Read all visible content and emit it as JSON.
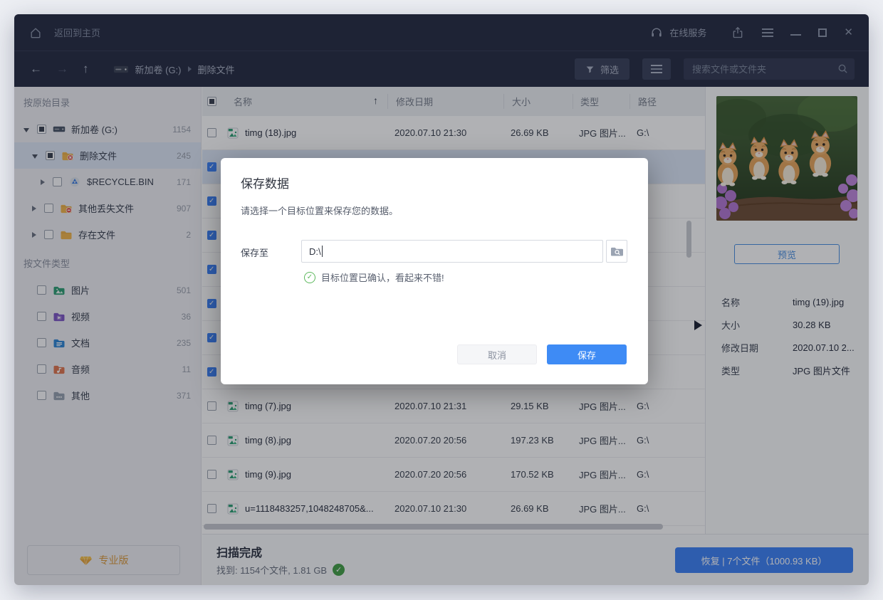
{
  "titlebar": {
    "home": "返回到主页",
    "online_service": "在线服务"
  },
  "toolbar": {
    "crumb_drive": "新加卷 (G:)",
    "crumb_folder": "删除文件",
    "filter": "筛选",
    "search_placeholder": "搜索文件或文件夹"
  },
  "sidebar": {
    "section_origin": "按原始目录",
    "section_types": "按文件类型",
    "origin_items": [
      {
        "label": "新加卷 (G:)",
        "count": "1154",
        "level": 0,
        "arrow": "down",
        "checkbox": "partial",
        "icon": "drive",
        "selected": false
      },
      {
        "label": "删除文件",
        "count": "245",
        "level": 1,
        "arrow": "down",
        "checkbox": "partial",
        "icon": "folder-deleted",
        "selected": true
      },
      {
        "label": "$RECYCLE.BIN",
        "count": "171",
        "level": 2,
        "arrow": "right",
        "checkbox": "empty",
        "icon": "recycle",
        "selected": false
      },
      {
        "label": "其他丢失文件",
        "count": "907",
        "level": 1,
        "arrow": "right",
        "checkbox": "empty",
        "icon": "folder-lost",
        "selected": false
      },
      {
        "label": "存在文件",
        "count": "2",
        "level": 1,
        "arrow": "right",
        "checkbox": "empty",
        "icon": "folder-plain",
        "selected": false
      }
    ],
    "type_items": [
      {
        "label": "图片",
        "count": "501",
        "icon": "folder-pictures"
      },
      {
        "label": "视频",
        "count": "36",
        "icon": "folder-videos"
      },
      {
        "label": "文档",
        "count": "235",
        "icon": "folder-docs"
      },
      {
        "label": "音频",
        "count": "11",
        "icon": "folder-audio"
      },
      {
        "label": "其他",
        "count": "371",
        "icon": "folder-other"
      }
    ],
    "pro_button": "专业版"
  },
  "file_list": {
    "columns": {
      "name": "名称",
      "date": "修改日期",
      "size": "大小",
      "type": "类型",
      "path": "路径"
    },
    "rows": [
      {
        "name": "timg (18).jpg",
        "date": "2020.07.10 21:30",
        "size": "26.69 KB",
        "type": "JPG 图片...",
        "path": "G:\\",
        "checked": false,
        "selected": false,
        "covered": false
      },
      {
        "name": "",
        "date": "",
        "size": "",
        "type": "",
        "path": "",
        "checked": true,
        "selected": true,
        "covered": true
      },
      {
        "name": "",
        "date": "",
        "size": "",
        "type": "",
        "path": "",
        "checked": true,
        "selected": false,
        "covered": true
      },
      {
        "name": "",
        "date": "",
        "size": "",
        "type": "",
        "path": "",
        "checked": true,
        "selected": false,
        "covered": true
      },
      {
        "name": "",
        "date": "",
        "size": "",
        "type": "",
        "path": "",
        "checked": true,
        "selected": false,
        "covered": true
      },
      {
        "name": "",
        "date": "",
        "size": "",
        "type": "",
        "path": "",
        "checked": true,
        "selected": false,
        "covered": true
      },
      {
        "name": "",
        "date": "",
        "size": "",
        "type": "",
        "path": "",
        "checked": true,
        "selected": false,
        "covered": true
      },
      {
        "name": "",
        "date": "",
        "size": "",
        "type": "",
        "path": "",
        "checked": true,
        "selected": false,
        "covered": true
      },
      {
        "name": "timg (7).jpg",
        "date": "2020.07.10 21:31",
        "size": "29.15 KB",
        "type": "JPG 图片...",
        "path": "G:\\",
        "checked": false,
        "selected": false,
        "covered": false
      },
      {
        "name": "timg (8).jpg",
        "date": "2020.07.20 20:56",
        "size": "197.23 KB",
        "type": "JPG 图片...",
        "path": "G:\\",
        "checked": false,
        "selected": false,
        "covered": false
      },
      {
        "name": "timg (9).jpg",
        "date": "2020.07.20 20:56",
        "size": "170.52 KB",
        "type": "JPG 图片...",
        "path": "G:\\",
        "checked": false,
        "selected": false,
        "covered": false
      },
      {
        "name": "u=1118483257,1048248705&...",
        "date": "2020.07.10 21:30",
        "size": "26.69 KB",
        "type": "JPG 图片...",
        "path": "G:\\",
        "checked": false,
        "selected": false,
        "covered": false
      }
    ]
  },
  "dialog": {
    "title": "保存数据",
    "description": "请选择一个目标位置来保存您的数据。",
    "save_to_label": "保存至",
    "path_value": "D:\\",
    "status_message": "目标位置已确认，看起来不错!",
    "cancel": "取消",
    "save": "保存"
  },
  "preview": {
    "button": "预览",
    "details": [
      {
        "label": "名称",
        "value": "timg (19).jpg"
      },
      {
        "label": "大小",
        "value": "30.28 KB"
      },
      {
        "label": "修改日期",
        "value": "2020.07.10 2..."
      },
      {
        "label": "类型",
        "value": "JPG 图片文件"
      }
    ]
  },
  "status_bar": {
    "title": "扫描完成",
    "summary": "找到: 1154个文件, 1.81 GB",
    "recover_button": "恢复 | 7个文件（1000.93 KB）"
  },
  "colors": {
    "accent_blue": "#3e82f7",
    "success_green": "#43a047",
    "brand_dark": "#262c42",
    "pro_orange": "#dc9b3e"
  }
}
